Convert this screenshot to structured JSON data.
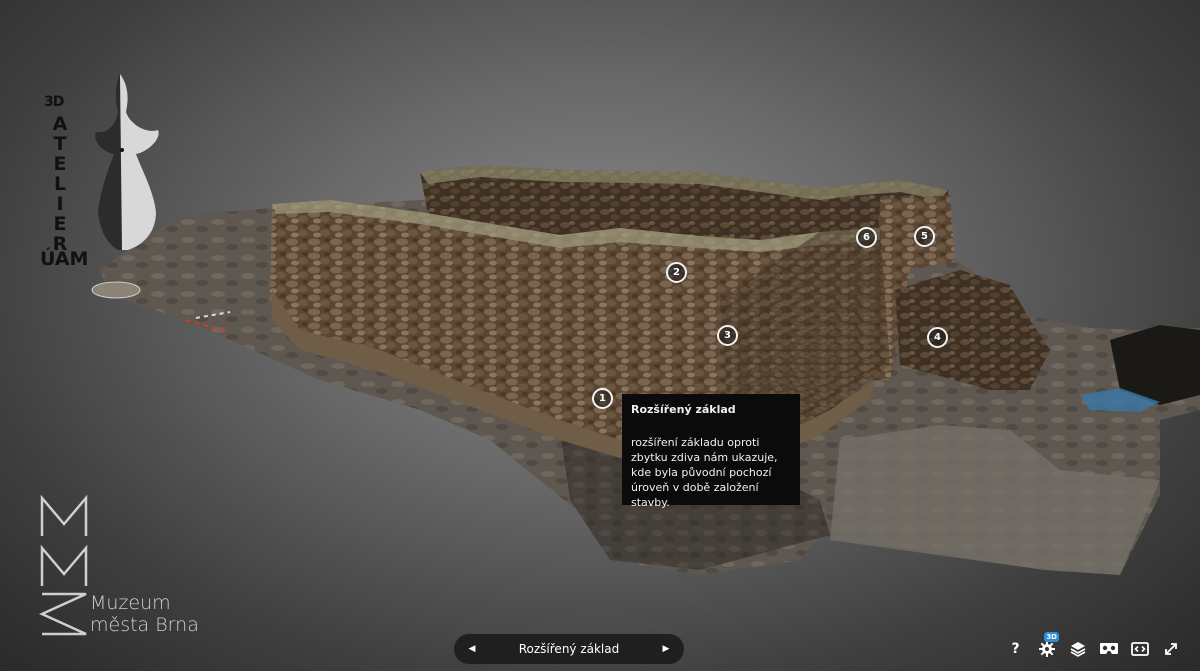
{
  "logos": {
    "atelier_prefix": "3D",
    "atelier_letters": [
      "A",
      "T",
      "E",
      "L",
      "I",
      "E",
      "R"
    ],
    "atelier_suffix": "ÚAM",
    "museum_line1": "Muzeum",
    "museum_line2": "města Brna"
  },
  "hotspots": [
    {
      "label": "1"
    },
    {
      "label": "2"
    },
    {
      "label": "3"
    },
    {
      "label": "4"
    },
    {
      "label": "5"
    },
    {
      "label": "6"
    }
  ],
  "tooltip": {
    "title": "Rozšířený základ",
    "body": "rozšíření základu oproti zbytku zdiva nám ukazuje, kde byla původní pochozí úroveň v době založení stavby."
  },
  "navigation": {
    "prev_icon": "◀",
    "next_icon": "▶",
    "current": "Rozšířený základ"
  },
  "controls": {
    "help": "?",
    "settings_badge": "3D",
    "icons": [
      "help-icon",
      "settings-icon",
      "layers-icon",
      "vr-icon",
      "fit-view-icon",
      "fullscreen-icon"
    ]
  },
  "colors": {
    "tooltip_bg": "#0b0b0b",
    "badge": "#2a8fd6"
  }
}
